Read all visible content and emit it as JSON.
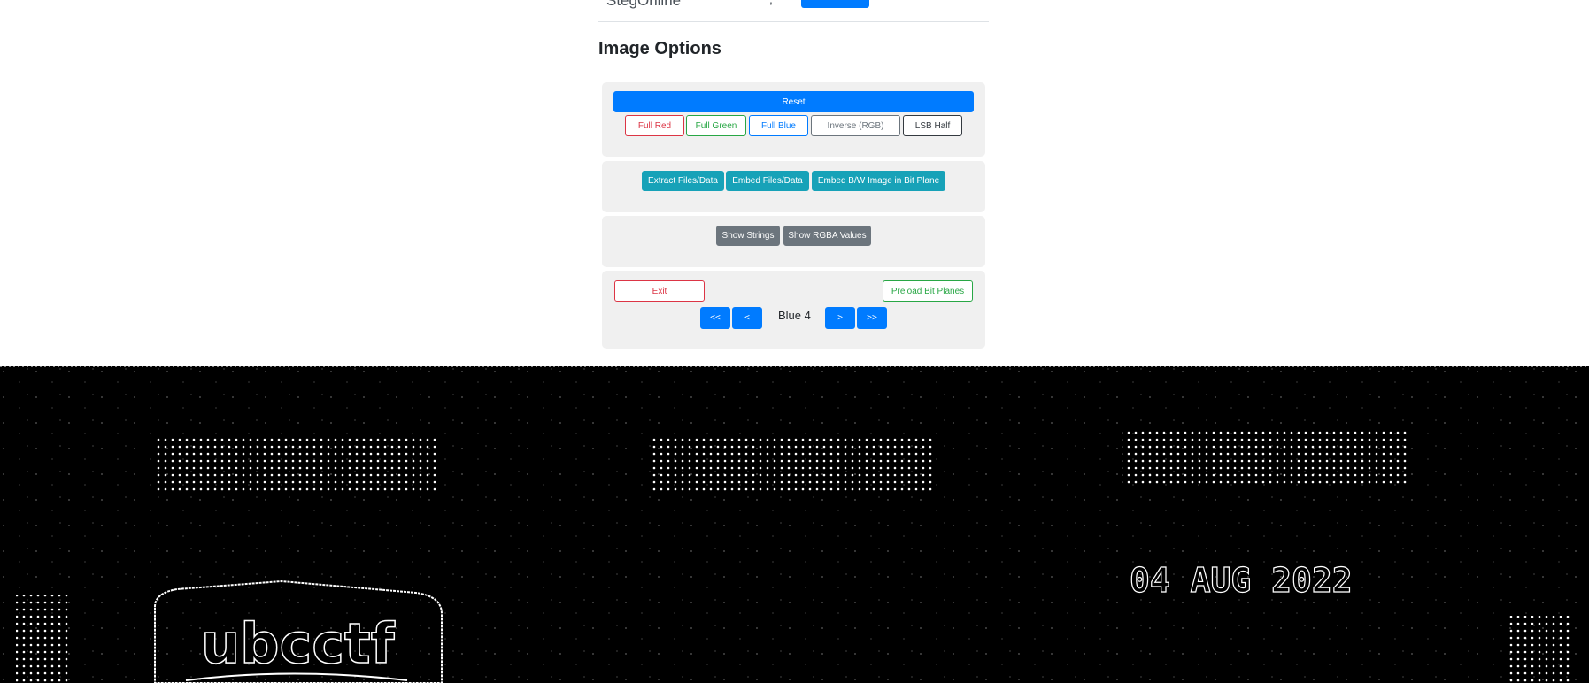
{
  "header": {
    "brand": "StegOnline",
    "separator": ","
  },
  "image_options": {
    "title": "Image Options",
    "reset_label": "Reset",
    "color_buttons": [
      {
        "label": "Full Red"
      },
      {
        "label": "Full Green"
      },
      {
        "label": "Full Blue"
      },
      {
        "label": "Inverse (RGB)"
      },
      {
        "label": "LSB Half"
      }
    ],
    "data_buttons": [
      {
        "label": "Extract Files/Data"
      },
      {
        "label": "Embed Files/Data"
      },
      {
        "label": "Embed B/W Image in Bit Plane"
      }
    ],
    "view_buttons": [
      {
        "label": "Show Strings"
      },
      {
        "label": "Show RGBA Values"
      }
    ],
    "exit_label": "Exit",
    "preload_label": "Preload Bit Planes",
    "nav": {
      "first": "<<",
      "prev": "<",
      "current_plane": "Blue 4",
      "next": ">",
      "last": ">>"
    }
  },
  "bitplane_image": {
    "logo_text": "ubcctf",
    "date_text": "04 AUG 2022"
  }
}
